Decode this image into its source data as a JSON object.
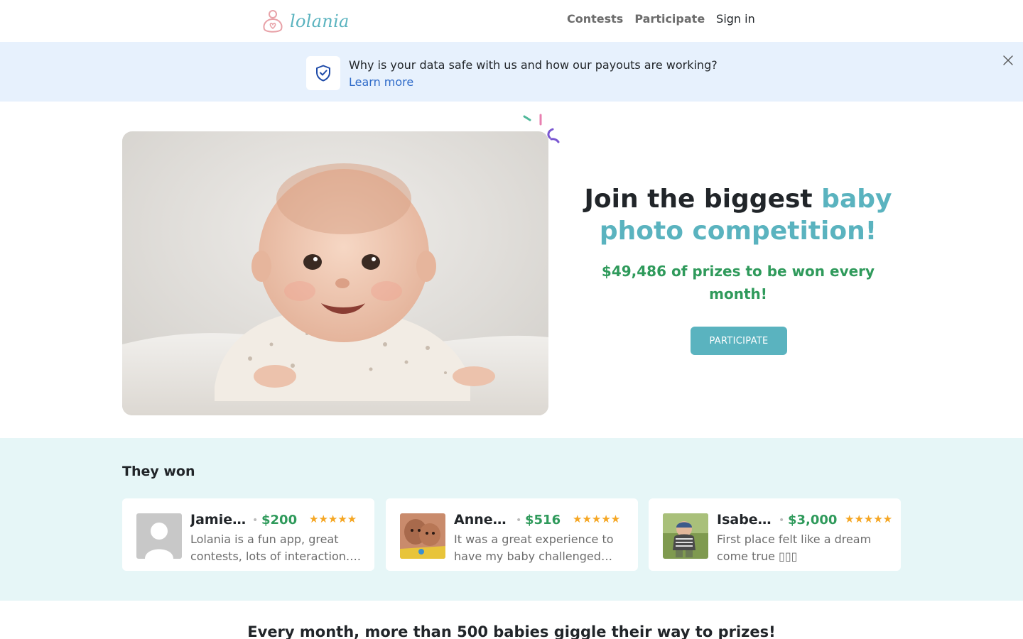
{
  "nav": {
    "logo_text": "lolania",
    "links": [
      "Contests",
      "Participate"
    ],
    "signin_label": "Sign in"
  },
  "banner": {
    "message": "Why is your data safe with us and how our payouts are working?",
    "link_label": "Learn more"
  },
  "hero": {
    "title_plain": "Join the biggest ",
    "title_accent": "baby photo competition!",
    "prize_text": "$49,486 of prizes to be won every month!",
    "cta_label": "PARTICIPATE"
  },
  "winners": {
    "title": "They won",
    "cards": [
      {
        "name": "Jamie…",
        "prize": "$200",
        "stars": "★★★★★",
        "text": "Lolania is a fun app, great contests, lots of interaction…."
      },
      {
        "name": "Anne…",
        "prize": "$516",
        "stars": "★★★★★",
        "text": "It was a great experience to have my baby challenged wi…"
      },
      {
        "name": "Isabe…",
        "prize": "$3,000",
        "stars": "★★★★★",
        "text": "First place felt like a dream come true ▯▯▯"
      }
    ]
  },
  "bottom": {
    "title": "Every month, more than 500 babies giggle their way to prizes!"
  },
  "colors": {
    "brand": "#5ab3bf",
    "prize_green": "#2f9a5b",
    "banner_bg": "#e7f1fd",
    "winners_bg": "#e6f6f7",
    "star": "#f5a623",
    "link_blue": "#2f6bc9"
  },
  "icons": [
    "lolania-logo-icon",
    "shield-check-icon",
    "close-icon",
    "confetti-icon",
    "star-icon",
    "avatar-placeholder-icon"
  ]
}
